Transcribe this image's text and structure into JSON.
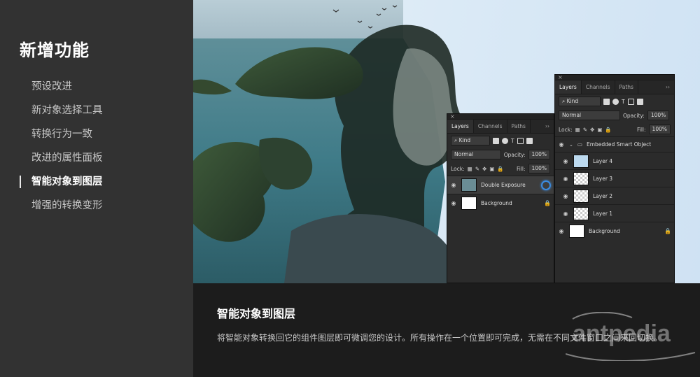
{
  "sidebar": {
    "title": "新增功能",
    "items": [
      {
        "label": "预设改进",
        "active": false
      },
      {
        "label": "新对象选择工具",
        "active": false
      },
      {
        "label": "转换行为一致",
        "active": false
      },
      {
        "label": "改进的属性面板",
        "active": false
      },
      {
        "label": "智能对象到图层",
        "active": true
      },
      {
        "label": "增强的转换变形",
        "active": false
      }
    ]
  },
  "panel_front": {
    "tabs": [
      "Layers",
      "Channels",
      "Paths"
    ],
    "more": "››",
    "filter": "Kind",
    "blend_mode": "Normal",
    "opacity_label": "Opacity:",
    "opacity_value": "100%",
    "lock_label": "Lock:",
    "fill_label": "Fill:",
    "fill_value": "100%",
    "layers": [
      {
        "name": "Double Exposure",
        "selected": true,
        "smart": true
      },
      {
        "name": "Background",
        "selected": false,
        "locked": true
      }
    ]
  },
  "panel_back": {
    "tabs": [
      "Layers",
      "Channels",
      "Paths"
    ],
    "more": "››",
    "filter": "Kind",
    "blend_mode": "Normal",
    "opacity_label": "Opacity:",
    "opacity_value": "100%",
    "lock_label": "Lock:",
    "fill_label": "Fill:",
    "fill_value": "100%",
    "group_name": "Embedded Smart Object",
    "layers": [
      {
        "name": "Layer 4"
      },
      {
        "name": "Layer 3"
      },
      {
        "name": "Layer 2"
      },
      {
        "name": "Layer 1"
      },
      {
        "name": "Background",
        "locked": true
      }
    ]
  },
  "caption": {
    "title": "智能对象到图层",
    "text": "将智能对象转换回它的组件图层即可微调您的设计。所有操作在一个位置即可完成，无需在不同文件窗口之间来回切换。"
  },
  "watermark": "antpedia",
  "colors": {
    "sidebar_bg": "#323232",
    "caption_bg": "#1c1c1c",
    "hero_sky": "#dbeaf6",
    "panel_bg": "#2b2b2b",
    "accent_blue": "#3b8be0"
  }
}
